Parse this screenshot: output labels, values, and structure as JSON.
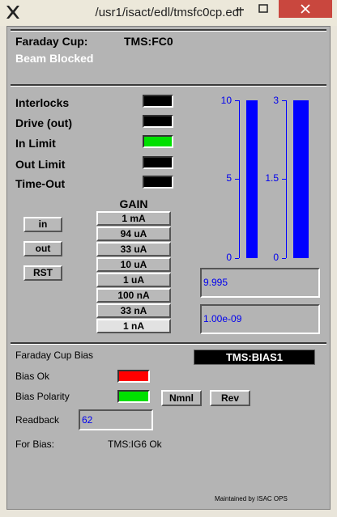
{
  "window": {
    "title": "/usr1/isact/edl/tmsfc0cp.edl"
  },
  "header": {
    "device_label": "Faraday Cup:",
    "device_name": "TMS:FC0",
    "status": "Beam Blocked"
  },
  "indicators": [
    {
      "label": "Interlocks",
      "color": "#000000"
    },
    {
      "label": "Drive (out)",
      "color": "#000000"
    },
    {
      "label": "In Limit",
      "color": "#00e000"
    },
    {
      "label": "Out Limit",
      "color": "#000000"
    },
    {
      "label": "Time-Out",
      "color": "#000000"
    }
  ],
  "buttons": {
    "in": "in",
    "out": "out",
    "rst": "RST"
  },
  "gain": {
    "title": "GAIN",
    "options": [
      "1 mA",
      "94 uA",
      "33 uA",
      "10 uA",
      "1 uA",
      "100 nA",
      "33 nA",
      "1 nA"
    ],
    "selected": "1 nA"
  },
  "bars": [
    {
      "ticks": [
        "10",
        "5",
        "0"
      ],
      "max": 10,
      "value": 9.995,
      "readout": "9.995"
    },
    {
      "ticks": [
        "3",
        "1.5",
        "0"
      ],
      "max": 3,
      "value": 3,
      "readout": "1.00e-09"
    }
  ],
  "bias": {
    "title": "Faraday Cup Bias",
    "pv_name": "TMS:BIAS1",
    "ok_label": "Bias Ok",
    "ok_color": "#ff0000",
    "polarity_label": "Bias Polarity",
    "polarity_color": "#00e000",
    "nml_button": "Nmnl",
    "rev_button": "Rev",
    "readback_label": "Readback",
    "readback_value": "62",
    "for_bias_label": "For Bias:",
    "for_bias_value": "TMS:IG6 Ok"
  },
  "footer": {
    "maintained": "Maintained by ISAC OPS"
  }
}
